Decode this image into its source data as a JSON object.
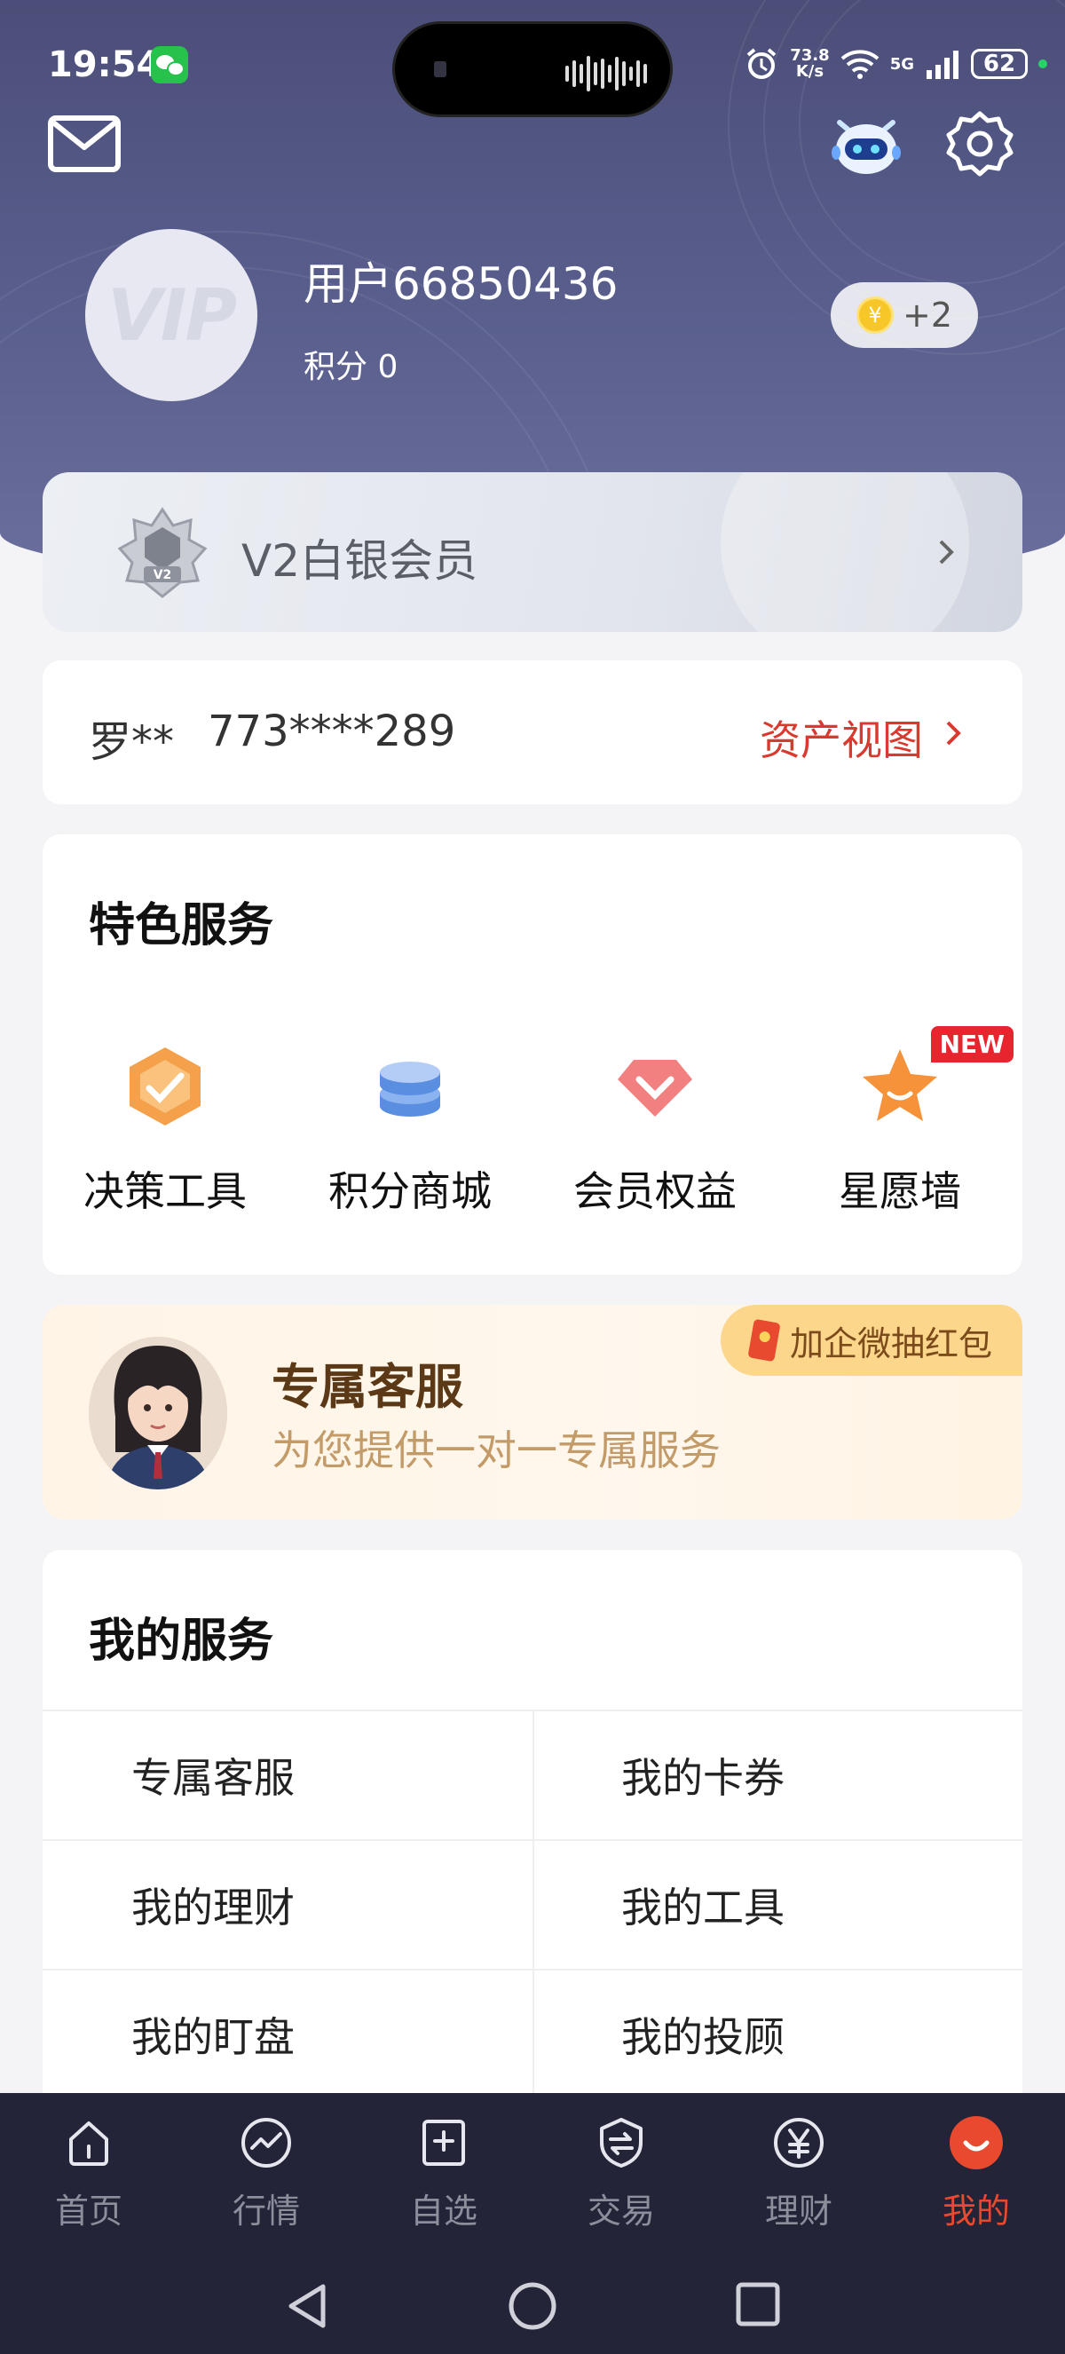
{
  "status_bar": {
    "time": "19:54",
    "net_speed_value": "73.8",
    "net_speed_unit": "K/s",
    "network": "5G",
    "battery": "62"
  },
  "profile": {
    "avatar_text": "VIP",
    "username": "用户66850436",
    "points": "积分 0",
    "coin_delta": "+2"
  },
  "membership": {
    "label": "V2白银会员",
    "badge_text": "V2"
  },
  "account": {
    "name": "罗**",
    "number": "773****289",
    "asset_link": "资产视图"
  },
  "featured": {
    "title": "特色服务",
    "items": [
      {
        "label": "决策工具",
        "icon": "decision-tool-icon"
      },
      {
        "label": "积分商城",
        "icon": "points-mall-icon"
      },
      {
        "label": "会员权益",
        "icon": "member-benefits-icon"
      },
      {
        "label": "星愿墙",
        "icon": "wish-wall-star-icon",
        "tag": "NEW"
      }
    ]
  },
  "customer_service": {
    "title": "专属客服",
    "subtitle": "为您提供一对一专属服务",
    "wechat_button": "加企微抽红包"
  },
  "my_services": {
    "title": "我的服务",
    "rows": [
      [
        "专属客服",
        "我的卡券"
      ],
      [
        "我的理财",
        "我的工具"
      ],
      [
        "我的盯盘",
        "我的投顾"
      ]
    ]
  },
  "tabbar": {
    "tabs": [
      {
        "label": "首页",
        "icon": "home-icon"
      },
      {
        "label": "行情",
        "icon": "market-icon"
      },
      {
        "label": "自选",
        "icon": "watchlist-icon"
      },
      {
        "label": "交易",
        "icon": "trade-icon"
      },
      {
        "label": "理财",
        "icon": "wealth-icon"
      },
      {
        "label": "我的",
        "icon": "me-icon",
        "active": true
      }
    ]
  },
  "colors": {
    "header": "#4b4e78",
    "accent_red": "#d9392e",
    "tabbar_bg": "#232437",
    "tab_active": "#e8492f"
  }
}
